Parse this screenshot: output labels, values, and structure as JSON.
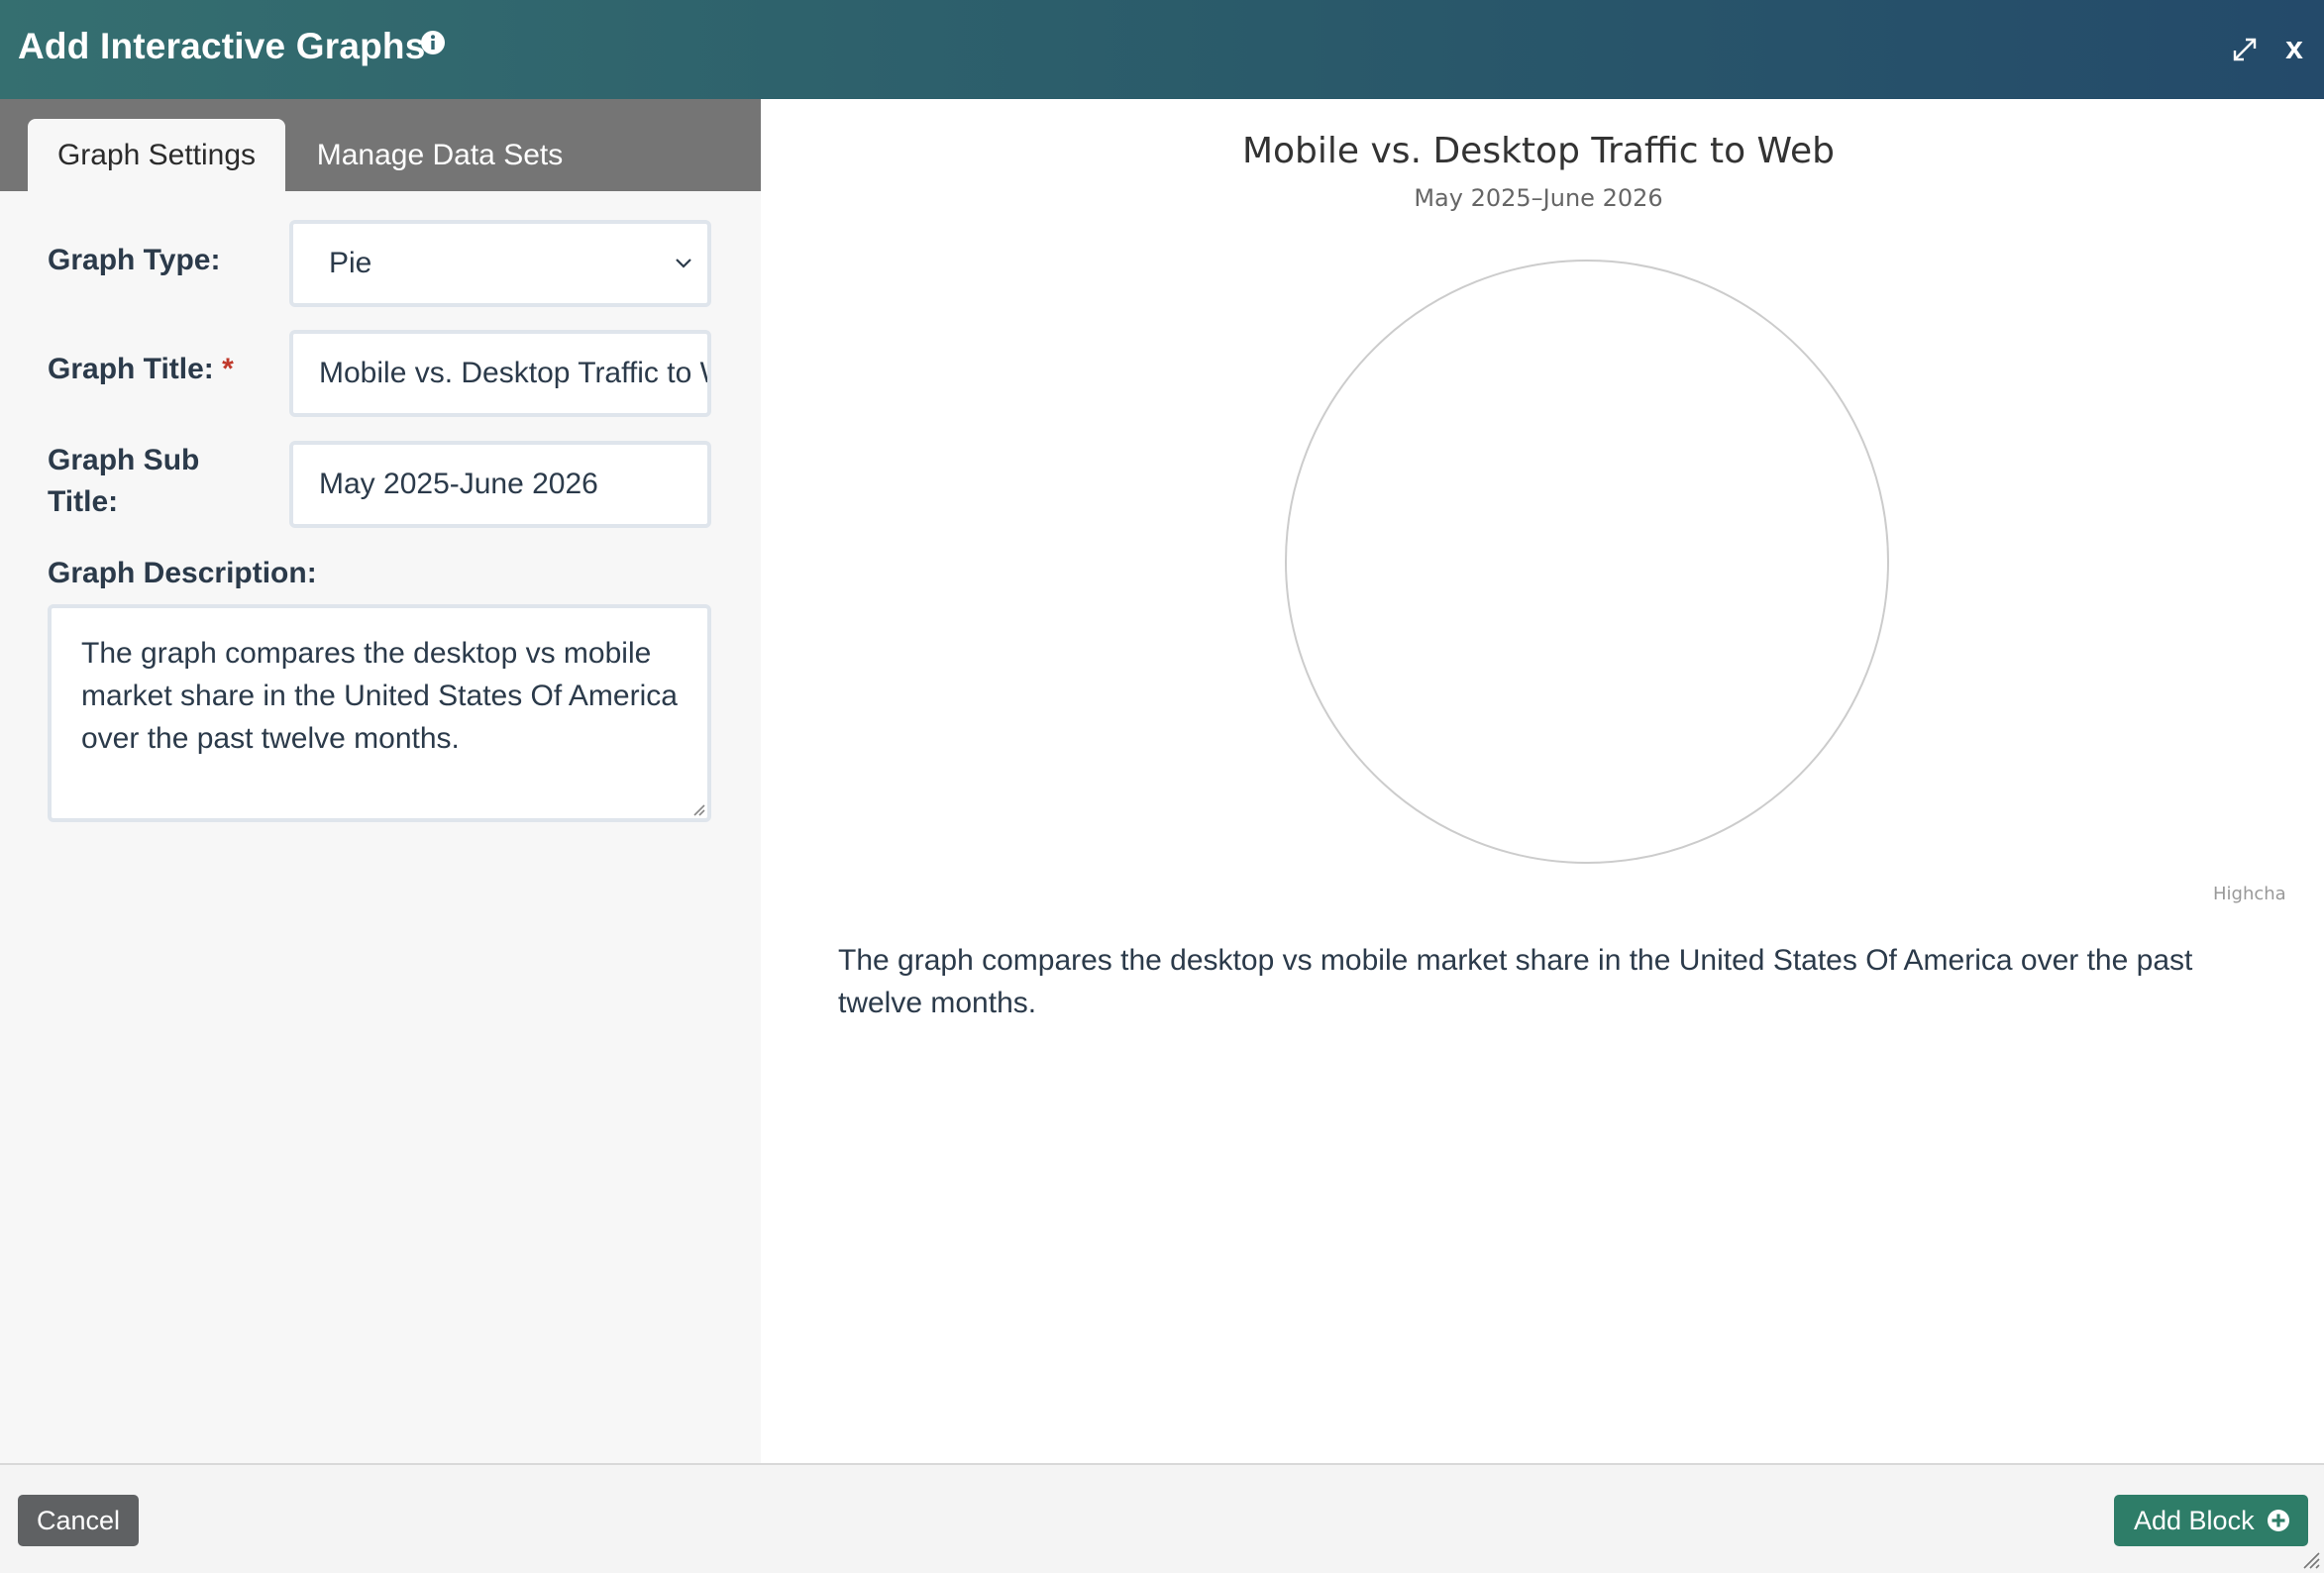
{
  "header": {
    "title": "Add Interactive Graphs",
    "icons": {
      "info": "info-icon",
      "expand": "expand-icon",
      "close": "close-icon"
    },
    "close_label": "x"
  },
  "tabs": [
    {
      "label": "Graph Settings",
      "active": true
    },
    {
      "label": "Manage Data Sets",
      "active": false
    }
  ],
  "form": {
    "graph_type": {
      "label": "Graph Type:",
      "value": "Pie"
    },
    "graph_title": {
      "label": "Graph Title:",
      "required_mark": "*",
      "value": "Mobile vs. Desktop Traffic to Web"
    },
    "graph_subtitle": {
      "label_line1": "Graph Sub",
      "label_line2": "Title:",
      "value": "May 2025-June 2026"
    },
    "graph_description": {
      "label": "Graph Description:",
      "value": "The graph compares the desktop vs mobile market share in the United States Of America over the past twelve months."
    }
  },
  "preview": {
    "description": "The graph compares the desktop vs mobile market share in the United States Of America over the past twelve months.",
    "credits": "Highcha"
  },
  "chart_data": {
    "type": "pie",
    "title": "Mobile vs. Desktop Traffic to Web",
    "subtitle": "May 2025–June 2026",
    "categories": [],
    "values": [],
    "empty_pie": true
  },
  "footer": {
    "cancel_label": "Cancel",
    "add_label": "Add Block"
  },
  "colors": {
    "header_start": "#356f70",
    "header_end": "#244a6a",
    "tab_bar": "#757575",
    "add_button": "#2e7d68",
    "cancel_button": "#5f6163",
    "required": "#c0392b"
  }
}
